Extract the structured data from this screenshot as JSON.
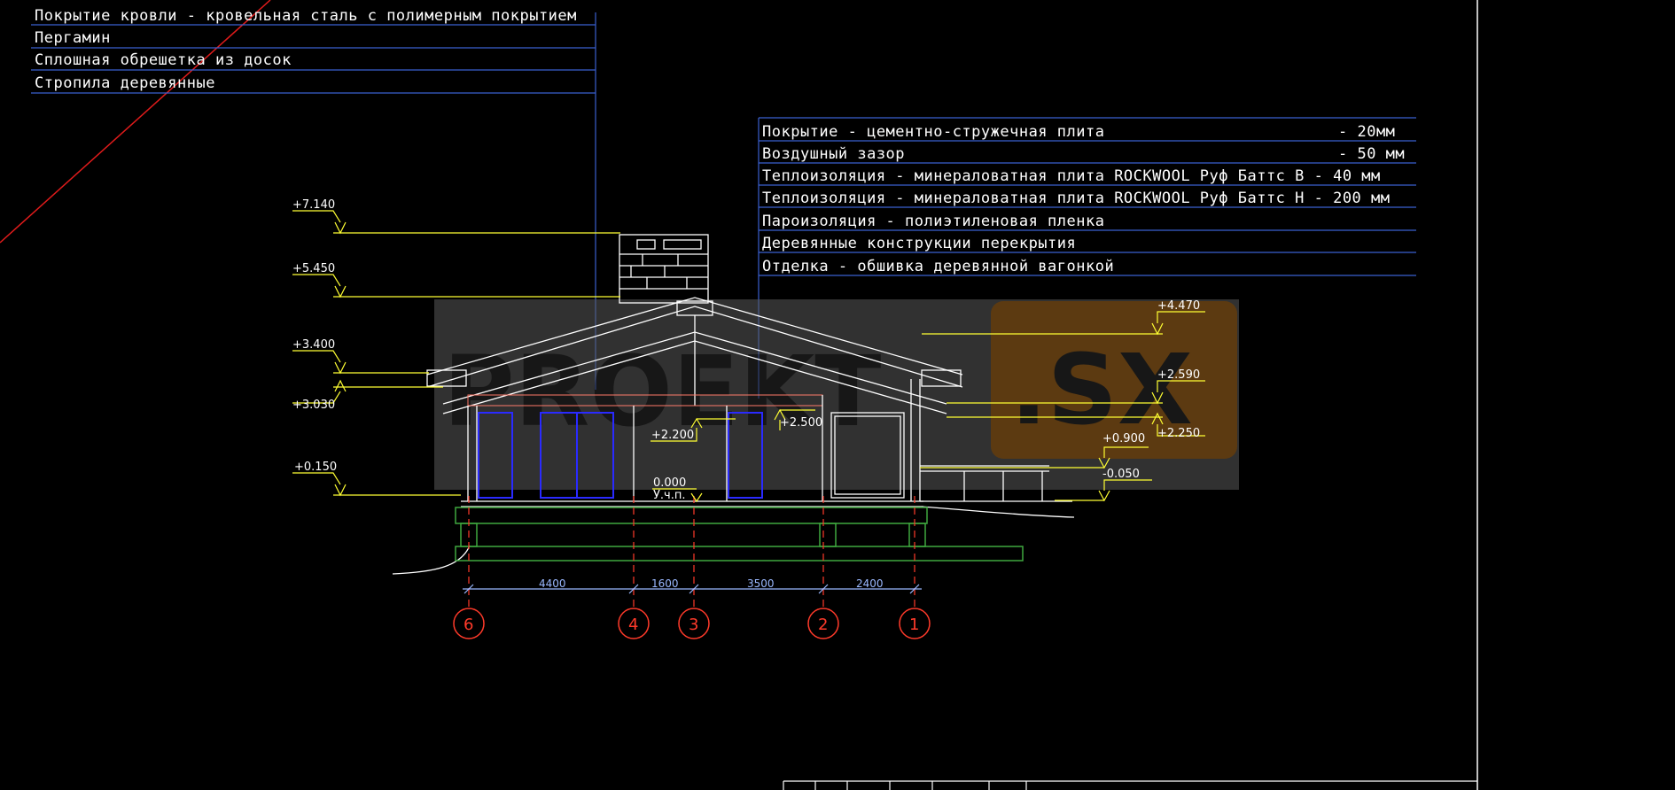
{
  "roof_layers": [
    "Покрытие кровли - кровельная сталь с полимерным покрытием",
    "Пергамин",
    "Сплошная обрешетка из досок",
    "Стропила деревянные"
  ],
  "ceiling_layers": [
    {
      "label": "Покрытие - цементно-стружечная плита",
      "value": "- 20мм"
    },
    {
      "label": "Воздушный зазор",
      "value": "- 50 мм"
    },
    {
      "label": "Теплоизоляция - минераловатная плита ROCKWOOL Руф Баттс В - 40 мм",
      "value": ""
    },
    {
      "label": "Теплоизоляция - минераловатная плита ROCKWOOL Руф Баттс Н - 200 мм",
      "value": ""
    },
    {
      "label": "Пароизоляция - полиэтиленовая пленка",
      "value": ""
    },
    {
      "label": "Деревянные конструкции перекрытия",
      "value": ""
    },
    {
      "label": "Отделка - обшивка деревянной вагонкой",
      "value": ""
    }
  ],
  "elevations_left": [
    "+7.140",
    "+5.450",
    "+3.400",
    "+3.030",
    "+0.150"
  ],
  "elevations_right": [
    "+4.470",
    "+2.590",
    "+2.250",
    "+0.900",
    "-0.050"
  ],
  "elevations_inner": {
    "a": "+2.200",
    "b": "+2.500",
    "zero": "0.000",
    "ground": "У.ч.п."
  },
  "dimensions": [
    "4400",
    "1600",
    "3500",
    "2400"
  ],
  "axes": [
    "6",
    "4",
    "3",
    "2",
    "1"
  ],
  "watermark": {
    "left": "PROEKT",
    "right": ".SX"
  },
  "colors": {
    "line": "#ffffff",
    "leader": "#3a5fcf",
    "elevation": "#ffff33",
    "axis": "#ff3a2a",
    "dimension": "#9ab8ff",
    "foundation": "#3fa83f",
    "window": "#2a2aff"
  }
}
